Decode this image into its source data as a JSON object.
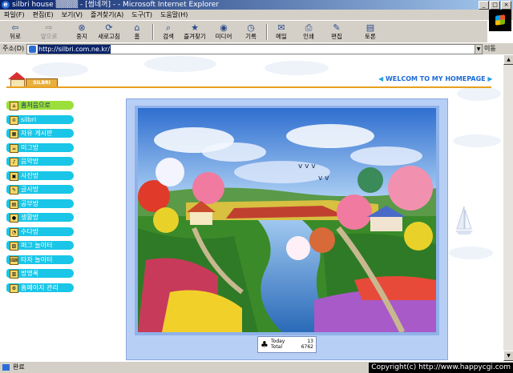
{
  "window": {
    "title": "silbri house ▒▒▒▒ - [썸네꺼] - - Microsoft Internet Explorer",
    "buttons": [
      "_",
      "□",
      "×"
    ]
  },
  "menubar": [
    "파일(F)",
    "편집(E)",
    "보기(V)",
    "즐겨찾기(A)",
    "도구(T)",
    "도움말(H)"
  ],
  "toolbar": {
    "back": "뒤로",
    "forward": "앞으로",
    "stop": "중지",
    "refresh": "새로고침",
    "home": "홈",
    "search": "검색",
    "favorites": "즐겨찾기",
    "media": "미디어",
    "history": "기록",
    "mail": "메일",
    "print": "인쇄",
    "edit": "편집",
    "discuss": "토론"
  },
  "address": {
    "label": "주소(D)",
    "url": "http://silbri.com.ne.kr/",
    "go": "이동"
  },
  "page": {
    "logo_text": "SILBRI",
    "welcome": "WELCOM TO MY HOMEPAGE",
    "menu": [
      "홈처음으로",
      "silbri",
      "자유 게시판",
      "미그방",
      "음악방",
      "사진방",
      "글사방",
      "공부방",
      "생활방",
      "수다방",
      "퍼그 놀이터",
      "타자 놀이터",
      "방명록",
      "홈페이지 관리"
    ],
    "counter": {
      "today_label": "Today",
      "today_value": "13",
      "total_label": "Total",
      "total_value": "6762"
    }
  },
  "status": {
    "text": "완료",
    "copyright": "Copyright(c) http://www.happycgi.com"
  }
}
